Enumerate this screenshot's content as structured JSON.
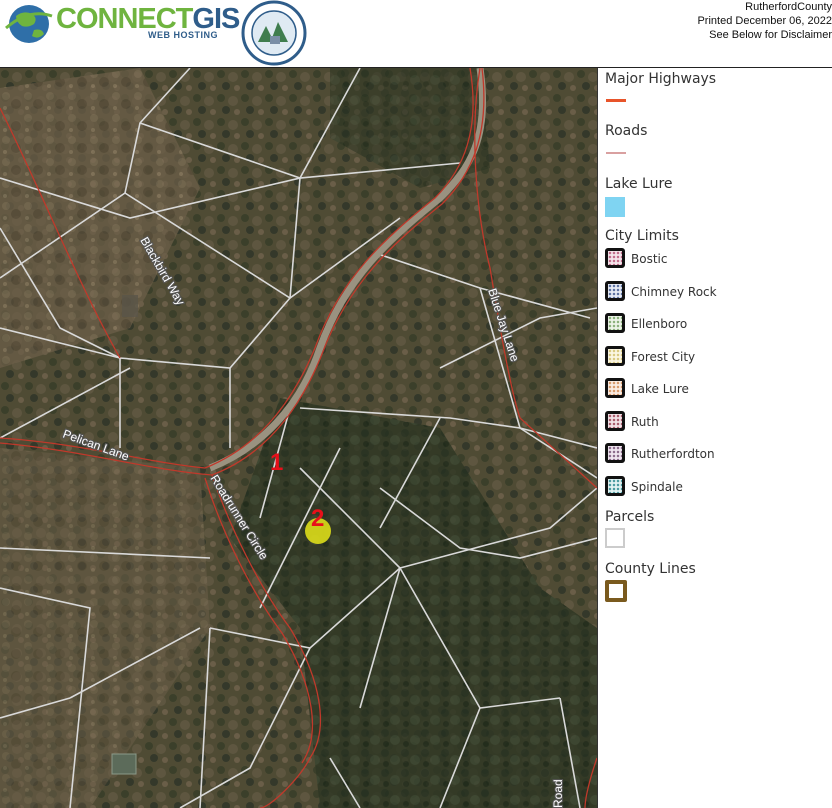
{
  "header": {
    "logo_word_1": "CONNECT",
    "logo_word_2": "GIS",
    "logo_sub": "WEB HOSTING",
    "county": "RutherfordCounty",
    "printed": "Printed December 06, 2022",
    "disclaimer": "See Below for Disclaimer"
  },
  "map": {
    "road_labels": {
      "blackbird": "Blackbird Way",
      "bluejay": "Blue Jay Lane",
      "pelican": "Pelican Lane",
      "roadrunner": "Roadrunner Circle",
      "road": "Road"
    },
    "markers": [
      {
        "label": "1"
      },
      {
        "label": "2"
      }
    ],
    "colors": {
      "parcel_line": "#d9d9d9",
      "road_line": "#c0392b",
      "highlight": "#e6e619"
    }
  },
  "legend": {
    "major_highways": "Major Highways",
    "roads": "Roads",
    "lake_lure": "Lake Lure",
    "city_limits": "City Limits",
    "cities": [
      "Bostic",
      "Chimney Rock",
      "Ellenboro",
      "Forest City",
      "Lake Lure",
      "Ruth",
      "Rutherfordton",
      "Spindale"
    ],
    "parcels": "Parcels",
    "county_lines": "County Lines",
    "colors": {
      "major_highway": "#e8542a",
      "road": "#d9a0a0",
      "lake": "#7fd4f2",
      "parcel_border": "#cccccc",
      "county_border": "#7a5a1e"
    }
  }
}
